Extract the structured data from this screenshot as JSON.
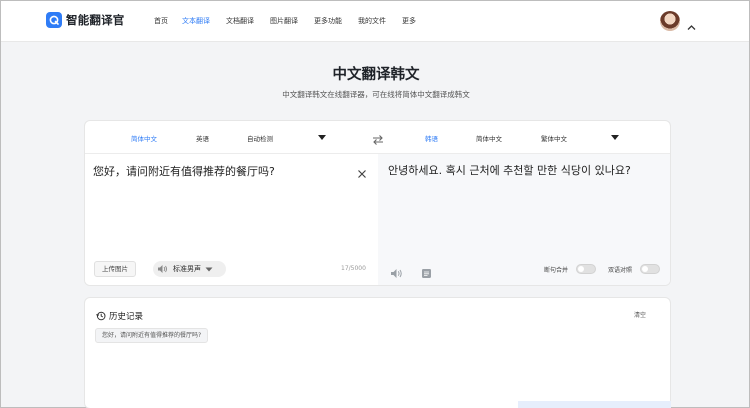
{
  "header": {
    "brand": "智能翻译官",
    "nav": [
      {
        "label": "首页",
        "active": false
      },
      {
        "label": "文本翻译",
        "active": true
      },
      {
        "label": "文档翻译",
        "active": false
      },
      {
        "label": "图片翻译",
        "active": false
      },
      {
        "label": "更多功能",
        "active": false
      },
      {
        "label": "我的文件",
        "active": false
      },
      {
        "label": "更多",
        "active": false
      }
    ]
  },
  "page": {
    "title": "中文翻译韩文",
    "subtitle": "中文翻译韩文在线翻译器，可在线将简体中文翻译成韩文"
  },
  "languages": {
    "source": [
      "简体中文",
      "英语",
      "自动检测"
    ],
    "target": [
      "韩语",
      "简体中文",
      "繁体中文"
    ]
  },
  "source": {
    "text": "您好，请问附近有值得推荐的餐厅吗?",
    "upload_label": "上传图片",
    "voice_label": "标准男声",
    "char_count": "17/5000"
  },
  "target": {
    "text": "안녕하세요. 혹시 근처에 추천할 만한 식당이 있나요?",
    "toggle_sentence": "断句合并",
    "toggle_bilingual": "双语对照"
  },
  "history": {
    "title": "历史记录",
    "clear_label": "清空",
    "items": [
      "您好，请问附近有值得推荐的餐厅吗?"
    ]
  },
  "colors": {
    "accent": "#2f7cf6",
    "background": "#f3f4f6",
    "target_pane": "#f7f8fa"
  }
}
